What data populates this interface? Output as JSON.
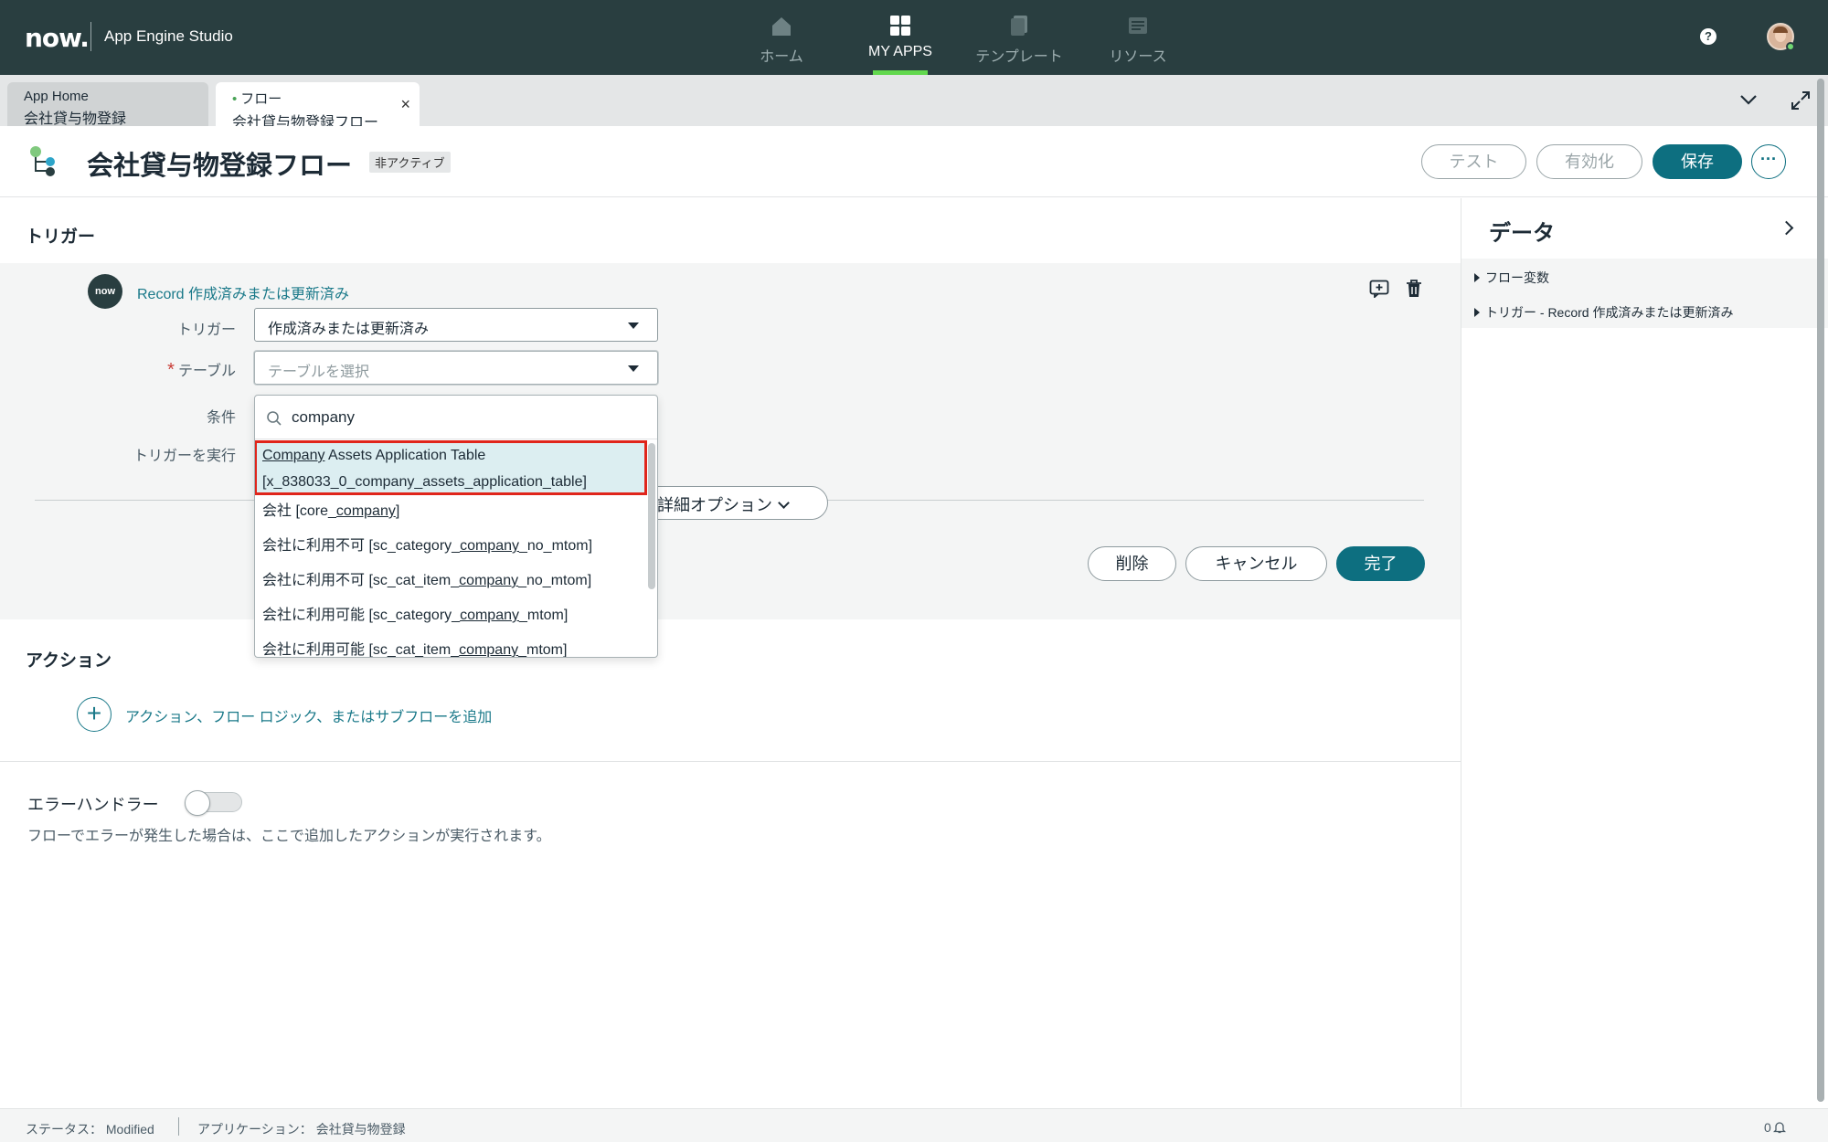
{
  "topbar": {
    "logo": "now.",
    "app_title": "App Engine Studio",
    "nav": [
      {
        "label": "ホーム",
        "icon": "home-icon"
      },
      {
        "label": "MY APPS",
        "icon": "grid-icon"
      },
      {
        "label": "テンプレート",
        "icon": "template-icon"
      },
      {
        "label": "リソース",
        "icon": "resources-icon"
      }
    ],
    "help": "?"
  },
  "tabs": [
    {
      "top": "App Home",
      "bottom": "会社貸与物登録"
    },
    {
      "top": "フロー",
      "bottom": "会社貸与物登録フロー",
      "close": "×"
    }
  ],
  "header": {
    "title": "会社貸与物登録フロー",
    "status": "非アクティブ",
    "buttons": {
      "test": "テスト",
      "activate": "有効化",
      "save": "保存",
      "more": "···"
    }
  },
  "trigger_section": {
    "title": "トリガー",
    "badge": "now",
    "link": "Record 作成済みまたは更新済み",
    "fields": {
      "trigger_label": "トリガー",
      "trigger_value": "作成済みまたは更新済み",
      "table_label": "テーブル",
      "required_mark": "*",
      "table_placeholder": "テーブルを選択",
      "condition_label": "条件",
      "run_label": "トリガーを実行"
    },
    "advanced": "詳細オプション",
    "buttons": {
      "delete": "削除",
      "cancel": "キャンセル",
      "done": "完了"
    }
  },
  "dropdown": {
    "search": "company",
    "items": [
      {
        "pre": "",
        "match": "Company",
        "post": " Assets Application Table",
        "line2": "[x_838033_0_company_assets_application_table]"
      },
      {
        "pre": "会社 [core_",
        "match": "company",
        "post": "]"
      },
      {
        "pre": "会社に利用不可 [sc_category_",
        "match": "company",
        "post": "_no_mtom]"
      },
      {
        "pre": "会社に利用不可 [sc_cat_item_",
        "match": "company",
        "post": "_no_mtom]"
      },
      {
        "pre": "会社に利用可能 [sc_category_",
        "match": "company",
        "post": "_mtom]"
      },
      {
        "pre": "会社に利用可能 [sc_cat_item_",
        "match": "company",
        "post": "_mtom]"
      }
    ]
  },
  "action_section": {
    "title": "アクション",
    "add_icon": "+",
    "add_link": "アクション、フロー ロジック、またはサブフローを追加"
  },
  "error_handler": {
    "label": "エラーハンドラー",
    "description": "フローでエラーが発生した場合は、ここで追加したアクションが実行されます。",
    "enabled": false
  },
  "data_panel": {
    "title": "データ",
    "items": [
      "フロー変数",
      "トリガー - Record 作成済みまたは更新済み"
    ]
  },
  "statusbar": {
    "status": "ステータス： Modified",
    "application": "アプリケーション： 会社貸与物登録",
    "count": "0"
  },
  "colors": {
    "topbar": "#293e40",
    "accent": "#0d6f80",
    "link": "#1a7989",
    "highlight_outline": "#e0251b",
    "active_nav": "#62d84e"
  }
}
